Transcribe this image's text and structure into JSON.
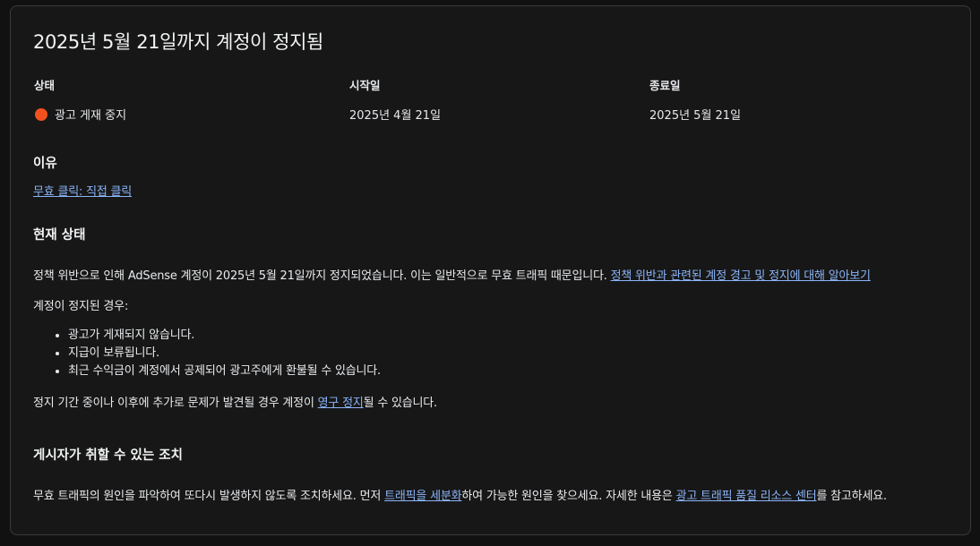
{
  "title": "2025년 5월 21일까지 계정이 정지됨",
  "summary": {
    "status_header": "상태",
    "start_header": "시작일",
    "end_header": "종료일",
    "status_value": "광고 게재 중지",
    "status_color": "#f4511e",
    "start_value": "2025년 4월 21일",
    "end_value": "2025년 5월 21일"
  },
  "reason": {
    "heading": "이유",
    "link": "무효 클릭: 직접 클릭"
  },
  "current_status": {
    "heading": "현재 상태",
    "paragraph_text": "정책 위반으로 인해 AdSense 계정이 2025년 5월 21일까지 정지되었습니다. 이는 일반적으로 무효 트래픽 때문입니다. ",
    "paragraph_link": "정책 위반과 관련된 계정 경고 및 정지에 대해 알아보기",
    "when_suspended": "계정이 정지된 경우:",
    "bullets": [
      "광고가 게재되지 않습니다.",
      "지급이 보류됩니다.",
      "최근 수익금이 계정에서 공제되어 광고주에게 환불될 수 있습니다."
    ],
    "closing_before": "정지 기간 중이나 이후에 추가로 문제가 발견될 경우 계정이 ",
    "closing_link": "영구 정지",
    "closing_after": "될 수 있습니다."
  },
  "actions": {
    "heading": "게시자가 취할 수 있는 조치",
    "text_1": "무효 트래픽의 원인을 파악하여 또다시 발생하지 않도록 조치하세요. 먼저 ",
    "link_1": "트래픽을 세분화",
    "text_2": "하여 가능한 원인을 찾으세요. 자세한 내용은 ",
    "link_2": "광고 트래픽 품질 리소스 센터",
    "text_3": "를 참고하세요."
  },
  "colors": {
    "background": "#111111",
    "card": "#171717",
    "link": "#8ab4f8"
  }
}
